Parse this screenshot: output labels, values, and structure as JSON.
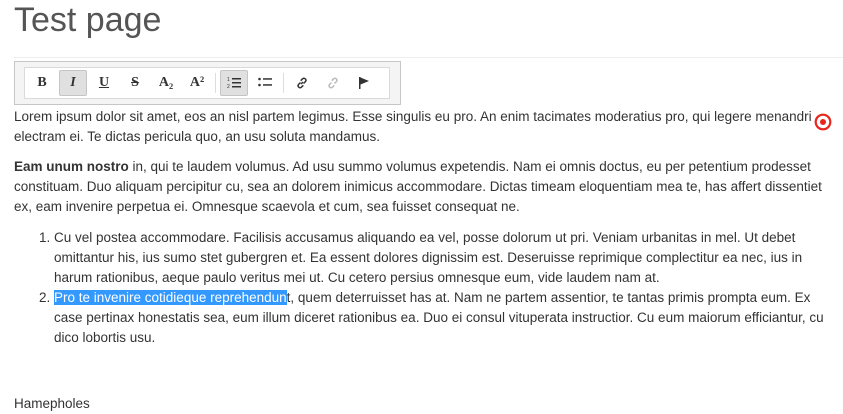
{
  "page": {
    "title": "Test page",
    "footer_partial": "Hamepholes"
  },
  "toolbar": {
    "buttons": [
      {
        "label": "B",
        "icon": "bold-icon",
        "active": false
      },
      {
        "label": "I",
        "icon": "italic-icon",
        "active": true
      },
      {
        "label": "U",
        "icon": "underline-icon",
        "active": false
      },
      {
        "label": "S",
        "icon": "strikethrough-icon",
        "active": false
      },
      {
        "label": "A₂",
        "icon": "subscript-icon",
        "active": false
      },
      {
        "label": "A²",
        "icon": "superscript-icon",
        "active": false
      },
      {
        "label": "",
        "icon": "numbered-list-icon",
        "active": true
      },
      {
        "label": "",
        "icon": "bulleted-list-icon",
        "active": false
      },
      {
        "label": "",
        "icon": "link-icon",
        "active": false
      },
      {
        "label": "",
        "icon": "unlink-icon",
        "active": false
      },
      {
        "label": "",
        "icon": "flag-icon",
        "active": false
      }
    ]
  },
  "content": {
    "p1": "Lorem ipsum dolor sit amet, eos an nisl partem legimus. Esse singulis eu pro. An enim tacimates moderatius pro, qui legere menandri electram ei. Te dictas pericula quo, an usu soluta mandamus.",
    "p2_bold": "Eam unum nostro",
    "p2_rest": " in, qui te laudem volumus. Ad usu summo volumus expetendis. Nam ei omnis doctus, eu per petentium prodesset constituam. Duo aliquam percipitur cu, sea an dolorem inimicus accommodare. Dictas timeam eloquentiam mea te, has affert dissentiet ex, eam invenire perpetua ei. Omnesque scaevola et cum, sea fuisset consequat ne.",
    "list": {
      "item1": "Cu vel postea accommodare. Facilisis accusamus aliquando ea vel, posse dolorum ut pri. Veniam urbanitas in mel. Ut debet omittantur his, ius sumo stet gubergren et. Ea essent dolores dignissim est. Deseruisse reprimique complectitur ea nec, ius in harum rationibus, aeque paulo veritus mei ut. Cu cetero persius omnesque eum, vide laudem nam at.",
      "item2_selected": "Pro te invenire cotidieque reprehendun",
      "item2_rest": "t, quem deterruisset has at. Nam ne partem assentior, te tantas primis prompta eum. Ex case pertinax honestatis sea, eum illum diceret rationibus ea. Duo ei consul vituperata instructior. Cu eum maiorum efficiantur, cu dico lobortis usu."
    }
  },
  "colors": {
    "selection": "#3399ff",
    "marker": "#e8251c"
  }
}
